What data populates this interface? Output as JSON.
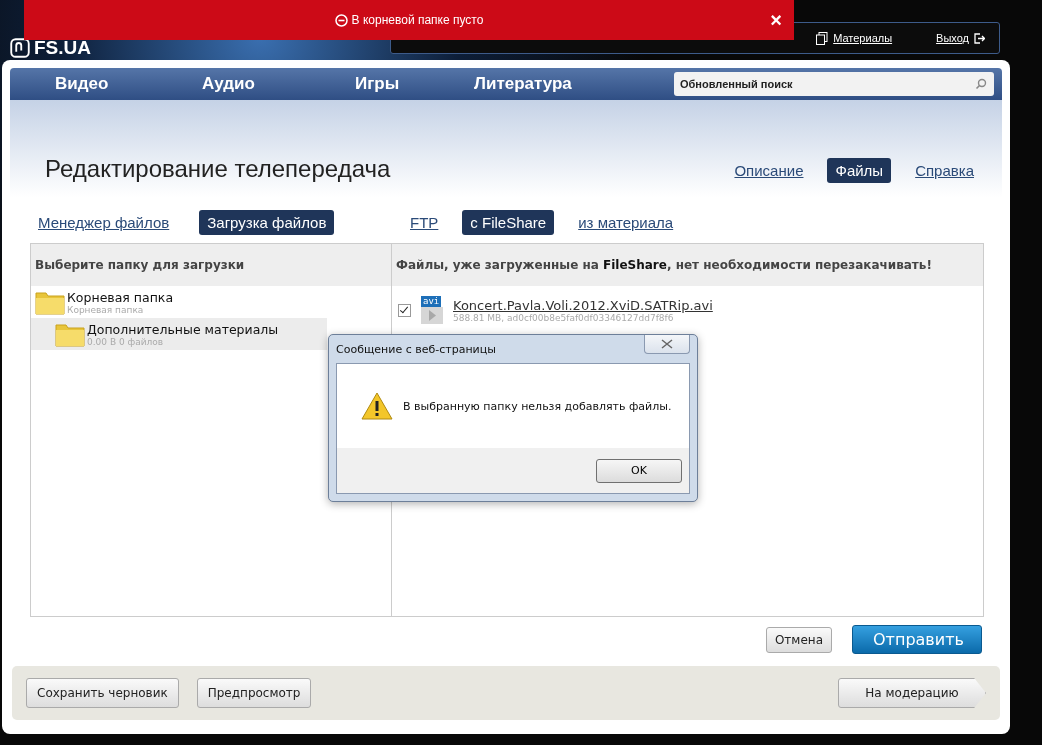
{
  "toast": {
    "text": "В корневой папке пусто",
    "close": "×"
  },
  "header": {
    "logo": "FS.UA",
    "links": [
      "Материалы",
      "Выход"
    ]
  },
  "nav": {
    "items": [
      "Видео",
      "Аудио",
      "Игры",
      "Литература"
    ],
    "search": {
      "placeholder": "Обновленный поиск"
    }
  },
  "title": "Редактирование телепередача",
  "page_tabs": [
    {
      "label": "Описание",
      "selected": false
    },
    {
      "label": "Файлы",
      "selected": true
    },
    {
      "label": "Справка",
      "selected": false
    }
  ],
  "mode_tabs": [
    {
      "label": "Менеджер файлов",
      "selected": false
    },
    {
      "label": "Загрузка файлов",
      "selected": true
    }
  ],
  "source_tabs": [
    {
      "label": "FTP",
      "selected": false
    },
    {
      "label": "с FileShare",
      "selected": true
    },
    {
      "label": "из материала",
      "selected": false
    }
  ],
  "folders": {
    "heading": "Выберите папку для загрузки",
    "tree": [
      {
        "name": "Корневая папка",
        "subtitle": "Корневая папка",
        "selected": false,
        "children": [
          {
            "name": "Дополнительные материалы",
            "subtitle": "0.00 B  0 файлов",
            "selected": true
          }
        ]
      }
    ]
  },
  "files": {
    "heading": "Файлы, уже загруженные на **FileShare**, нет необходимости перезакачивать!",
    "items": [
      {
        "checked": true,
        "badge": "avi",
        "name": "Koncert.Pavla.Voli.2012.XviD.SATRip.avi",
        "meta": "588.81 MB, ad0cf00b8e5faf0df03346127dd7f8f6"
      }
    ]
  },
  "actions": [
    "Отмена",
    "Отправить"
  ],
  "footer": {
    "left": [
      "Сохранить черновик",
      "Предпросмотр"
    ],
    "right": "На модерацию"
  },
  "dialog": {
    "title": "Сообщение с веб-страницы",
    "message": "В выбранную папку нельзя добавлять файлы.",
    "button": "OK"
  }
}
